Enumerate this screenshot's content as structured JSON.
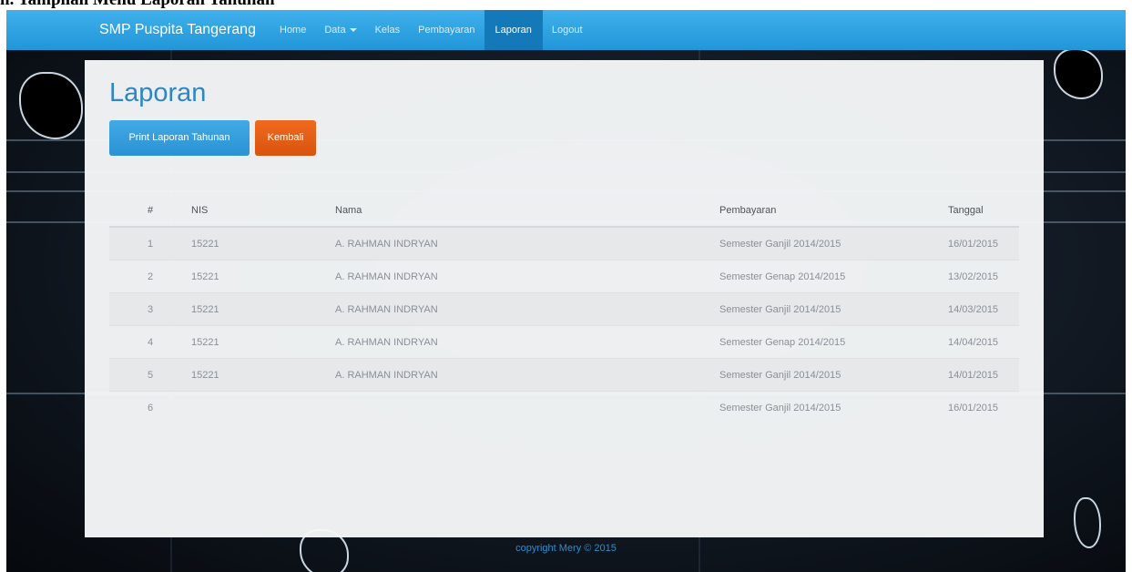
{
  "caption": "n.   Tampilan Menu Laporan Tahunan",
  "navbar": {
    "brand": "SMP Puspita Tangerang",
    "items": [
      {
        "label": "Home",
        "active": false
      },
      {
        "label": "Data",
        "active": false,
        "dropdown": true
      },
      {
        "label": "Kelas",
        "active": false
      },
      {
        "label": "Pembayaran",
        "active": false
      },
      {
        "label": "Laporan",
        "active": true
      },
      {
        "label": "Logout",
        "active": false
      }
    ]
  },
  "main": {
    "title": "Laporan",
    "print_button": "Print Laporan Tahunan",
    "back_button": "Kembali"
  },
  "table": {
    "headers": [
      "#",
      "NIS",
      "Nama",
      "Pembayaran",
      "Tanggal"
    ],
    "rows": [
      [
        "1",
        "15221",
        "A. RAHMAN INDRYAN",
        "Semester Ganjil 2014/2015",
        "16/01/2015"
      ],
      [
        "2",
        "15221",
        "A. RAHMAN INDRYAN",
        "Semester Genap 2014/2015",
        "13/02/2015"
      ],
      [
        "3",
        "15221",
        "A. RAHMAN INDRYAN",
        "Semester Ganjil 2014/2015",
        "14/03/2015"
      ],
      [
        "4",
        "15221",
        "A. RAHMAN INDRYAN",
        "Semester Genap 2014/2015",
        "14/04/2015"
      ],
      [
        "5",
        "15221",
        "A. RAHMAN INDRYAN",
        "Semester Ganjil 2014/2015",
        "14/01/2015"
      ],
      [
        "6",
        "",
        "",
        "Semester Ganjil 2014/2015",
        "16/01/2015"
      ]
    ]
  },
  "footer": "copyright Mery © 2015",
  "colors": {
    "navbar": "#2ea3e3",
    "nav_active": "#1479b8",
    "print_button": "#3aa0dc",
    "back_button": "#e5601a",
    "title": "#2f86c4"
  }
}
